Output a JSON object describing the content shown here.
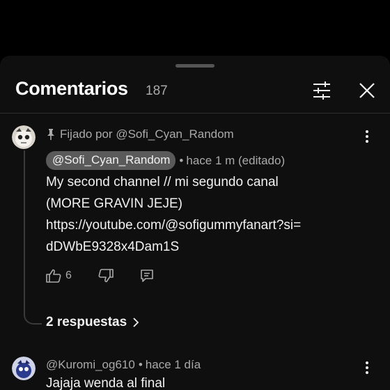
{
  "header": {
    "title": "Comentarios",
    "count": "187"
  },
  "comments": [
    {
      "pinned_label": "Fijado por @Sofi_Cyan_Random",
      "author": "@Sofi_Cyan_Random",
      "time": "hace 1 m (editado)",
      "text": "My  second channel // mi segundo canal\n(MORE GRAVIN JEJE)\nhttps://youtube.com/@sofigummyfanart?si=\ndDWbE9328x4Dam1S",
      "likes": "6",
      "replies_label": "2 respuestas"
    },
    {
      "author": "@Kuromi_og610",
      "time": "hace 1 día",
      "text": "Jajaja wenda al final"
    }
  ],
  "icons": {
    "filter": "sliders-icon",
    "close": "close-icon",
    "pin": "pin-icon",
    "like": "thumb-up-icon",
    "dislike": "thumb-down-icon",
    "reply": "reply-icon",
    "more": "more-vert-icon",
    "chevron": "chevron-right-icon"
  },
  "colors": {
    "sheet_bg": "#0f0f0f",
    "author_chip_bg": "#5a5a5a",
    "secondary_text": "#aaaaaa"
  }
}
